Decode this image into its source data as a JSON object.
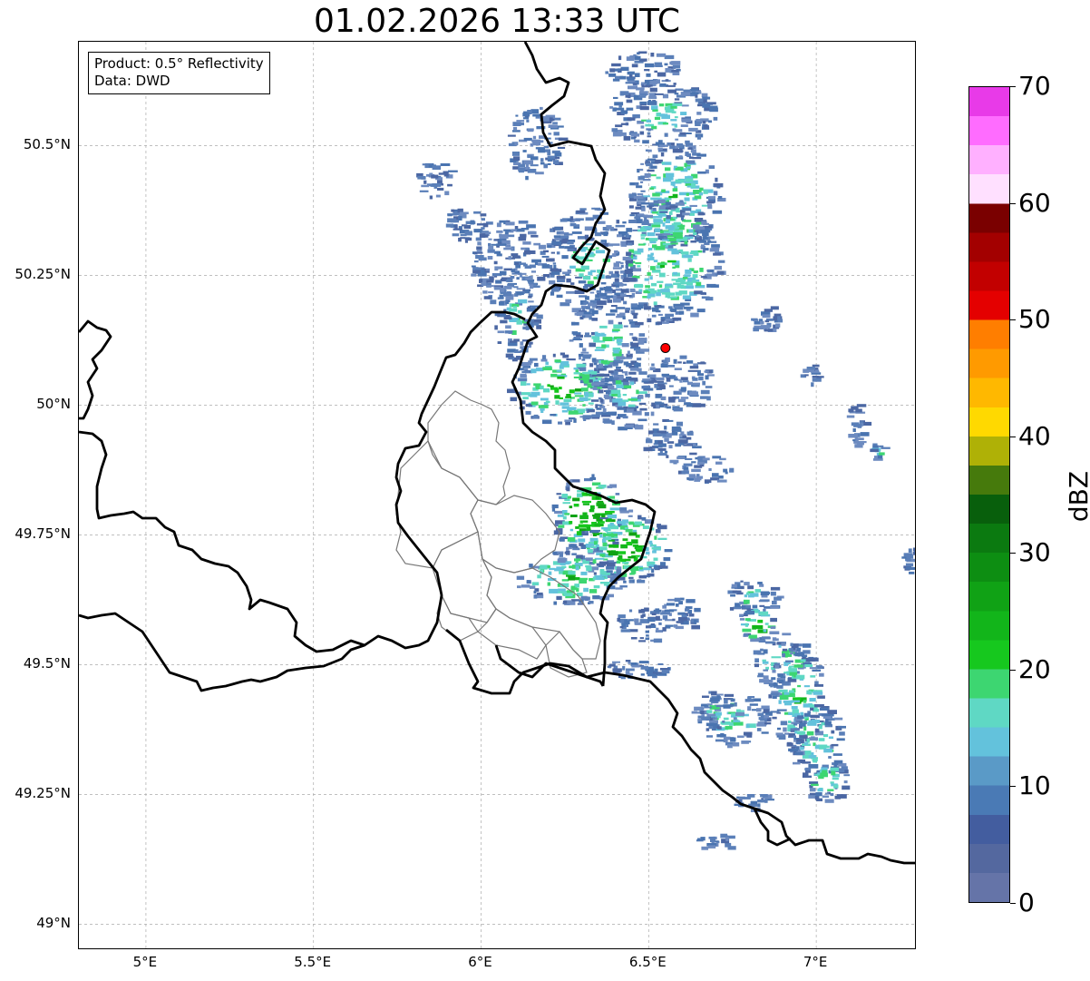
{
  "title": "01.02.2026 13:33 UTC",
  "info": {
    "product": "Product: 0.5° Reflectivity",
    "data": "Data: DWD"
  },
  "axes": {
    "lat_labels": [
      {
        "value": 50.5,
        "text": "50.5°N"
      },
      {
        "value": 50.25,
        "text": "50.25°N"
      },
      {
        "value": 50.0,
        "text": "50°N"
      },
      {
        "value": 49.75,
        "text": "49.75°N"
      },
      {
        "value": 49.5,
        "text": "49.5°N"
      },
      {
        "value": 49.25,
        "text": "49.25°N"
      },
      {
        "value": 49.0,
        "text": "49°N"
      }
    ],
    "lon_labels": [
      {
        "value": 5.0,
        "text": "5°E"
      },
      {
        "value": 5.5,
        "text": "5.5°E"
      },
      {
        "value": 6.0,
        "text": "6°E"
      },
      {
        "value": 6.5,
        "text": "6.5°E"
      },
      {
        "value": 7.0,
        "text": "7°E"
      }
    ],
    "lon_range": [
      4.8,
      7.3
    ],
    "lat_range": [
      48.95,
      50.7
    ],
    "grid": true
  },
  "radar_site": {
    "lon": 6.55,
    "lat": 50.11,
    "color": "#ff0000"
  },
  "colorbar": {
    "label": "dBZ",
    "range": [
      0,
      70
    ],
    "ticks": [
      "0",
      "10",
      "20",
      "30",
      "40",
      "50",
      "60",
      "70"
    ],
    "colors": [
      "#6574a8",
      "#54689f",
      "#435d9f",
      "#4a7ab5",
      "#5a9ac7",
      "#63c2dc",
      "#5fd8c4",
      "#3dd671",
      "#16c81e",
      "#12b51a",
      "#10a215",
      "#0d8e12",
      "#0b7a10",
      "#085f0c",
      "#467a0c",
      "#afb106",
      "#ffd900",
      "#ffb800",
      "#ff9a00",
      "#ff7e00",
      "#e40000",
      "#c20000",
      "#a30000",
      "#7a0000",
      "#ffe0ff",
      "#ffb0ff",
      "#ff6cff",
      "#e83ae8"
    ]
  }
}
